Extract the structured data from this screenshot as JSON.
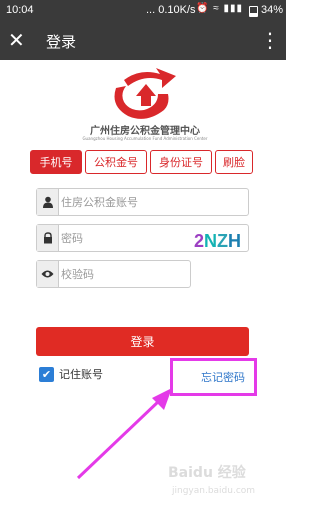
{
  "status_bar": {
    "time": "10:04",
    "network_speed": "... 0.10K/s",
    "signal_icons": "⏰ ≈ ▮▮▮",
    "battery": "34%",
    "battery_level": 0.34
  },
  "title_bar": {
    "close_icon": "✕",
    "title": "登录",
    "more_icon": "⋮"
  },
  "logo": {
    "org_name": "广州住房公积金管理中心",
    "org_name_en": "Guangzhou Housing Accumulation Fund Administration Center"
  },
  "tabs": [
    {
      "label": "手机号",
      "active": true
    },
    {
      "label": "公积金号",
      "active": false
    },
    {
      "label": "身份证号",
      "active": false
    },
    {
      "label": "刷脸",
      "active": false
    }
  ],
  "form": {
    "account_placeholder": "住房公积金账号",
    "password_placeholder": "密码",
    "captcha_placeholder": "校验码",
    "captcha_text": [
      "2",
      "N",
      "Z",
      "H"
    ],
    "captcha_colors": [
      "#9c3fc3",
      "#13b3b3",
      "#2aa3b5",
      "#1c7fb0"
    ]
  },
  "login_button": "登录",
  "remember": {
    "label": "记住账号",
    "checked": true
  },
  "forgot_password": "忘记密码",
  "watermark": {
    "text": "Baidu 经验",
    "url": "jingyan.baidu.com"
  },
  "colors": {
    "accent": "#d9282b",
    "highlight": "#e43ae8",
    "link": "#2e76c9"
  }
}
